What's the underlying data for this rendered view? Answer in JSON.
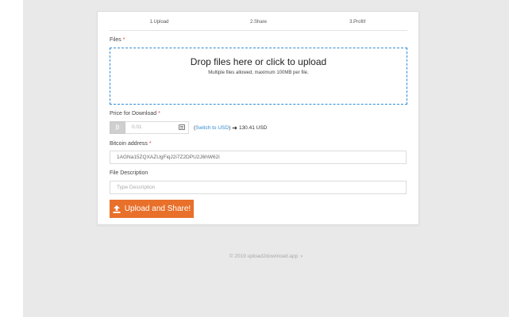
{
  "steps": [
    "1.Upload",
    "2.Share",
    "3.Profit!"
  ],
  "files": {
    "label": "Files",
    "required_mark": "*",
    "dropzone_title": "Drop files here or click to upload",
    "dropzone_sub": "Multiple files allowed, maximum 100MB per file."
  },
  "price": {
    "label": "Price for Download",
    "required_mark": "*",
    "currency_symbol": "₿",
    "placeholder": "0.01",
    "switch_link": "Switch to USD",
    "paren_open": "(",
    "paren_close": ")",
    "usd_value": "130.41 USD"
  },
  "bitcoin": {
    "label": "Bitcoin address",
    "required_mark": "*",
    "value": "1AGNa15ZQXAZUgFiqJ2i7Z2DPU2J6hW62i"
  },
  "description": {
    "label": "File Description",
    "placeholder": "Type Description"
  },
  "upload_button": "Upload and Share!",
  "footer": {
    "copyright": "© 2019 upload2download.app",
    "heart": "♥"
  },
  "colors": {
    "accent": "#e8702a",
    "link": "#2e8bd6",
    "required": "#e0443c"
  }
}
